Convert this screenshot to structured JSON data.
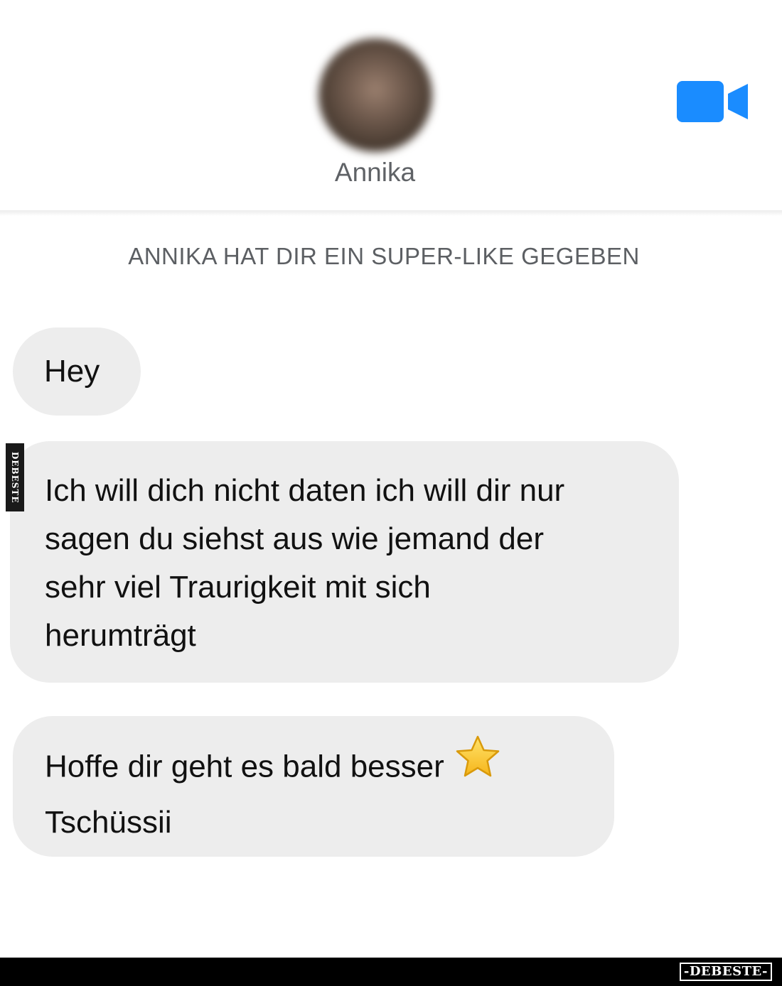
{
  "header": {
    "contact_name": "Annika",
    "video_call_icon": "video-camera-icon",
    "accent_color": "#1a8cff"
  },
  "system_message": "ANNIKA HAT DIR EIN SUPER-LIKE GEGEBEN",
  "messages": [
    {
      "lines": [
        "Hey"
      ]
    },
    {
      "lines": [
        "Ich will dich nicht daten ich will dir nur",
        "sagen du siehst aus wie jemand der",
        "sehr viel Traurigkeit mit sich",
        "herumträgt"
      ]
    },
    {
      "lines": [
        "Hoffe dir geht es bald besser",
        "Tschüssii"
      ],
      "emoji": "star-emoji"
    }
  ],
  "watermark": {
    "side": "DEBESTE",
    "footer": "-DEBESTE-"
  }
}
